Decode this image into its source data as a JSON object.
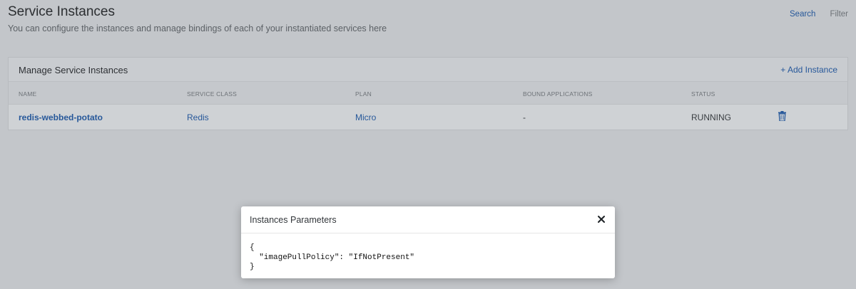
{
  "header": {
    "title": "Service Instances",
    "subtitle": "You can configure the instances and manage bindings of each of your instantiated services here",
    "search_label": "Search",
    "filter_label": "Filter"
  },
  "panel": {
    "title": "Manage Service Instances",
    "add_label": "+ Add Instance",
    "columns": [
      "NAME",
      "SERVICE CLASS",
      "PLAN",
      "BOUND APPLICATIONS",
      "STATUS"
    ],
    "rows": [
      {
        "name": "redis-webbed-potato",
        "service_class": "Redis",
        "plan": "Micro",
        "bound_applications": "-",
        "status": "RUNNING",
        "action_icon": "trash-icon"
      }
    ]
  },
  "modal": {
    "title": "Instances Parameters",
    "close_icon": "close-icon",
    "code_line1": "{",
    "code_line2": "  \"imagePullPolicy\": \"IfNotPresent\"",
    "code_line3": "}"
  },
  "colors": {
    "accent": "#27589a",
    "overlay_background": "#c3c6ca",
    "modal_background": "#ffffff"
  }
}
